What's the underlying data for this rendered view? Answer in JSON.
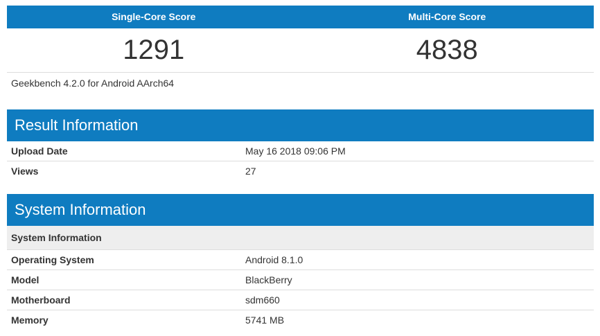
{
  "scores": {
    "single_label": "Single-Core Score",
    "multi_label": "Multi-Core Score",
    "single_value": "1291",
    "multi_value": "4838"
  },
  "version": "Geekbench 4.2.0 for Android AArch64",
  "result": {
    "title": "Result Information",
    "rows": [
      {
        "key": "Upload Date",
        "value": "May 16 2018 09:06 PM"
      },
      {
        "key": "Views",
        "value": "27"
      }
    ]
  },
  "system": {
    "title": "System Information",
    "subheader": "System Information",
    "rows": [
      {
        "key": "Operating System",
        "value": "Android 8.1.0"
      },
      {
        "key": "Model",
        "value": "BlackBerry"
      },
      {
        "key": "Motherboard",
        "value": "sdm660"
      },
      {
        "key": "Memory",
        "value": "5741 MB"
      }
    ]
  },
  "colors": {
    "header_blue": "#0f7cc0",
    "subheader_gray": "#eeeeee"
  }
}
